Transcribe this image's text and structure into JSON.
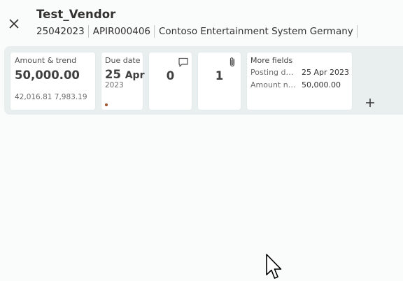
{
  "header": {
    "title": "Test_Vendor",
    "subtitle": [
      "25042023",
      "APIR000406",
      "Contoso Entertainment System Germany"
    ]
  },
  "cards": {
    "amount": {
      "label": "Amount & trend",
      "value": "50,000.00",
      "trend": "42,016.81 7,983.19"
    },
    "due": {
      "label": "Due date",
      "day": "25",
      "month": "Apr",
      "year": "2023"
    },
    "comments": {
      "count": "0",
      "icon": "comment-icon"
    },
    "attachments": {
      "count": "1",
      "icon": "paperclip-icon"
    },
    "more_fields": {
      "label": "More fields",
      "rows": [
        {
          "key": "Posting date",
          "value": "25 Apr 2023"
        },
        {
          "key": "Amount no...",
          "value": "50,000.00"
        }
      ]
    }
  },
  "colors": {
    "factbox_bg": "#e9efee",
    "card_bg": "#ffffff",
    "due_dot": "#a0522d"
  }
}
